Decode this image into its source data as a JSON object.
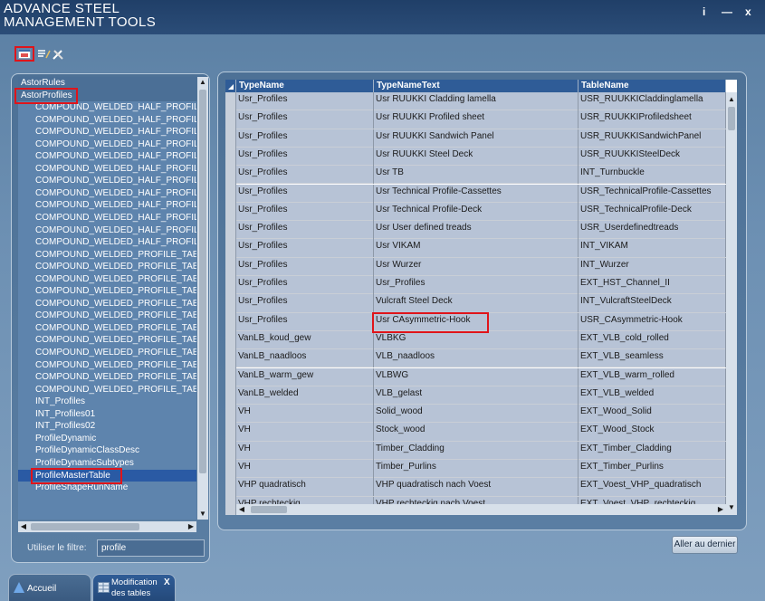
{
  "app": {
    "title_line1": "ADVANCE STEEL",
    "title_line2": "MANAGEMENT TOOLS"
  },
  "window_controls": {
    "info": "i",
    "minimize": "—",
    "close": "x"
  },
  "tree": {
    "items": [
      {
        "label": "AstorRules",
        "root": true
      },
      {
        "label": "AstorProfiles",
        "root": true,
        "highlighted": true
      },
      {
        "label": "COMPOUND_WELDED_HALF_PROFILE_TABLE"
      },
      {
        "label": "COMPOUND_WELDED_HALF_PROFILE_TABLE"
      },
      {
        "label": "COMPOUND_WELDED_HALF_PROFILE_TABLE"
      },
      {
        "label": "COMPOUND_WELDED_HALF_PROFILE_TABLE"
      },
      {
        "label": "COMPOUND_WELDED_HALF_PROFILE_TABLE"
      },
      {
        "label": "COMPOUND_WELDED_HALF_PROFILE_TABLE"
      },
      {
        "label": "COMPOUND_WELDED_HALF_PROFILE_TABLE"
      },
      {
        "label": "COMPOUND_WELDED_HALF_PROFILE_TABLE"
      },
      {
        "label": "COMPOUND_WELDED_HALF_PROFILE_TABLE"
      },
      {
        "label": "COMPOUND_WELDED_HALF_PROFILE_TABLE"
      },
      {
        "label": "COMPOUND_WELDED_HALF_PROFILE_TABLE"
      },
      {
        "label": "COMPOUND_WELDED_HALF_PROFILE_TABLE"
      },
      {
        "label": "COMPOUND_WELDED_PROFILE_TABLE"
      },
      {
        "label": "COMPOUND_WELDED_PROFILE_TABLE"
      },
      {
        "label": "COMPOUND_WELDED_PROFILE_TABLE"
      },
      {
        "label": "COMPOUND_WELDED_PROFILE_TABLE"
      },
      {
        "label": "COMPOUND_WELDED_PROFILE_TABLE"
      },
      {
        "label": "COMPOUND_WELDED_PROFILE_TABLE"
      },
      {
        "label": "COMPOUND_WELDED_PROFILE_TABLE"
      },
      {
        "label": "COMPOUND_WELDED_PROFILE_TABLE"
      },
      {
        "label": "COMPOUND_WELDED_PROFILE_TABLE"
      },
      {
        "label": "COMPOUND_WELDED_PROFILE_TABLE"
      },
      {
        "label": "COMPOUND_WELDED_PROFILE_TABLE"
      },
      {
        "label": "COMPOUND_WELDED_PROFILE_TABLE"
      },
      {
        "label": "INT_Profiles"
      },
      {
        "label": "INT_Profiles01"
      },
      {
        "label": "INT_Profiles02"
      },
      {
        "label": "ProfileDynamic"
      },
      {
        "label": "ProfileDynamicClassDesc"
      },
      {
        "label": "ProfileDynamicSubtypes"
      },
      {
        "label": "ProfileMasterTable",
        "selected": true,
        "highlighted": true
      },
      {
        "label": "ProfileShapeRunName"
      }
    ]
  },
  "filter": {
    "label": "Utiliser le filtre:",
    "value": "profile"
  },
  "grid": {
    "columns": [
      "TypeName",
      "TypeNameText",
      "TableName"
    ],
    "rows": [
      [
        "Usr_Profiles",
        "Usr RUUKKI Cladding lamella",
        "USR_RUUKKICladdinglamella"
      ],
      [
        "Usr_Profiles",
        "Usr RUUKKI Profiled sheet",
        "USR_RUUKKIProfiledsheet"
      ],
      [
        "Usr_Profiles",
        "Usr RUUKKI Sandwich Panel",
        "USR_RUUKKISandwichPanel"
      ],
      [
        "Usr_Profiles",
        "Usr RUUKKI Steel Deck",
        "USR_RUUKKISteelDeck"
      ],
      [
        "Usr_Profiles",
        "Usr TB",
        "INT_Turnbuckle"
      ],
      [
        "Usr_Profiles",
        "Usr Technical Profile-Cassettes",
        "USR_TechnicalProfile-Cassettes"
      ],
      [
        "Usr_Profiles",
        "Usr Technical Profile-Deck",
        "USR_TechnicalProfile-Deck"
      ],
      [
        "Usr_Profiles",
        "Usr User defined treads",
        "USR_Userdefinedtreads"
      ],
      [
        "Usr_Profiles",
        "Usr VIKAM",
        "INT_VIKAM"
      ],
      [
        "Usr_Profiles",
        "Usr Wurzer",
        "INT_Wurzer"
      ],
      [
        "Usr_Profiles",
        "Usr_Profiles",
        "EXT_HST_Channel_II"
      ],
      [
        "Usr_Profiles",
        "Vulcraft Steel Deck",
        "INT_VulcraftSteelDeck"
      ],
      [
        "Usr_Profiles",
        "Usr CAsymmetric-Hook",
        "USR_CAsymmetric-Hook"
      ],
      [
        "VanLB_koud_gew",
        "VLBKG",
        "EXT_VLB_cold_rolled"
      ],
      [
        "VanLB_naadloos",
        "VLB_naadloos",
        "EXT_VLB_seamless"
      ],
      [
        "VanLB_warm_gew",
        "VLBWG",
        "EXT_VLB_warm_rolled"
      ],
      [
        "VanLB_welded",
        "VLB_gelast",
        "EXT_VLB_welded"
      ],
      [
        "VH",
        "Solid_wood",
        "EXT_Wood_Solid"
      ],
      [
        "VH",
        "Stock_wood",
        "EXT_Wood_Stock"
      ],
      [
        "VH",
        "Timber_Cladding",
        "EXT_Timber_Cladding"
      ],
      [
        "VH",
        "Timber_Purlins",
        "EXT_Timber_Purlins"
      ],
      [
        "VHP quadratisch",
        "VHP quadratisch nach Voest",
        "EXT_Voest_VHP_quadratisch"
      ],
      [
        "VHP rechteckig",
        "VHP rechteckig nach Voest",
        "EXT_Voest_VHP_rechteckig"
      ]
    ]
  },
  "buttons": {
    "go_last": "Aller au dernier"
  },
  "tabs": [
    {
      "label": "Accueil"
    },
    {
      "label_line1": "Modification",
      "label_line2": "des tables",
      "close": "X"
    }
  ],
  "colors": {
    "highlight": "#e0141a",
    "titlebar": "#203f68",
    "header": "#2f5c97"
  }
}
